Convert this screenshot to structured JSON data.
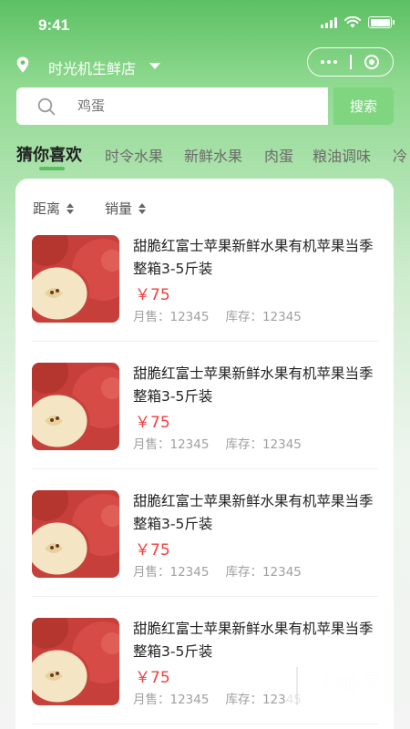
{
  "status_bar": {
    "time": "9:41"
  },
  "nav": {
    "store_name": "时光机生鲜店",
    "icons": [
      "location-pin-icon",
      "caret-down-icon",
      "more-dots-icon",
      "target-icon"
    ]
  },
  "search": {
    "placeholder": "鸡蛋",
    "button_label": "搜索"
  },
  "tabs": [
    {
      "label": "猜你喜欢",
      "active": true
    },
    {
      "label": "时令水果",
      "active": false
    },
    {
      "label": "新鲜水果",
      "active": false
    },
    {
      "label": "肉蛋",
      "active": false
    },
    {
      "label": "粮油调味",
      "active": false
    },
    {
      "label": "冷",
      "active": false
    }
  ],
  "sort": {
    "distance_label": "距离",
    "sales_label": "销量"
  },
  "products": [
    {
      "title": "甜脆红富士苹果新鲜水果有机苹果当季整箱3-5斤装",
      "price": "￥75",
      "monthly_sales": "月售：12345",
      "stock": "库存：12345"
    },
    {
      "title": "甜脆红富士苹果新鲜水果有机苹果当季整箱3-5斤装",
      "price": "￥75",
      "monthly_sales": "月售：12345",
      "stock": "库存：12345"
    },
    {
      "title": "甜脆红富士苹果新鲜水果有机苹果当季整箱3-5斤装",
      "price": "￥75",
      "monthly_sales": "月售：12345",
      "stock": "库存：12345"
    },
    {
      "title": "甜脆红富士苹果新鲜水果有机苹果当季整箱3-5斤装",
      "price": "￥75",
      "monthly_sales": "月售：12345",
      "stock": "库存：12345"
    }
  ],
  "watermark": {
    "text": "七叶子",
    "sub": "7YZ.COM"
  },
  "colors": {
    "brand_green": "#5cc062",
    "search_button": "#7fd580",
    "price_red": "#f0403e"
  }
}
